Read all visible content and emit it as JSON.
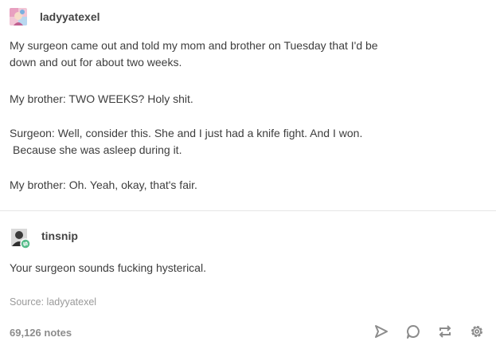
{
  "post": {
    "author": "ladyyatexel",
    "paragraphs": [
      {
        "lines": [
          "My surgeon came out and told my mom and brother on Tuesday that I'd be",
          "down and out for about two weeks."
        ]
      },
      {
        "lines": [
          "My brother: TWO WEEKS? Holy shit."
        ]
      },
      {
        "lines": [
          "Surgeon: Well, consider this.  She and I just had a knife fight.  And I won.",
          "Because she was asleep during it."
        ]
      },
      {
        "lines": [
          "My brother: Oh.  Yeah, okay, that's fair."
        ]
      }
    ]
  },
  "reblog": {
    "author": "tinsnip",
    "text": "Your surgeon sounds fucking hysterical."
  },
  "footer": {
    "source": "Source: ladyyatexel",
    "notes": "69,126 notes"
  },
  "colors": {
    "reblog_badge": "#56bc8a",
    "icon_gray": "#8c8c8c"
  },
  "icons": [
    "share-icon",
    "reply-icon",
    "reblog-icon",
    "settings-icon"
  ]
}
